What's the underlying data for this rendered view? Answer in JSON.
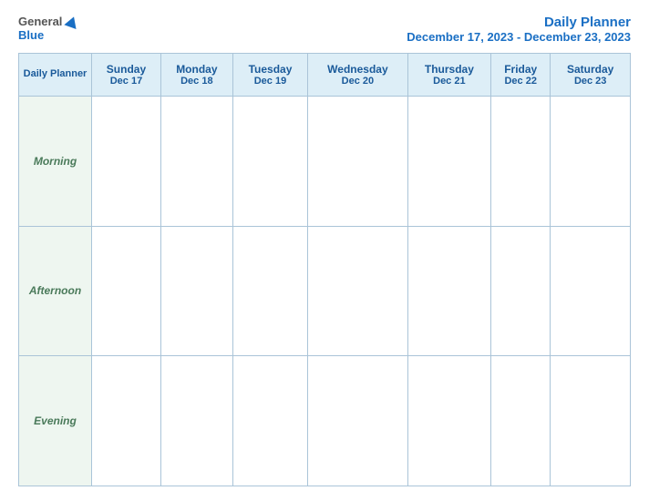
{
  "header": {
    "logo_general": "General",
    "logo_blue": "Blue",
    "title_main": "Daily Planner",
    "title_sub": "December 17, 2023 - December 23, 2023"
  },
  "table": {
    "daily_planner_label": "Daily Planner",
    "columns": [
      {
        "day": "Sunday",
        "date": "Dec 17"
      },
      {
        "day": "Monday",
        "date": "Dec 18"
      },
      {
        "day": "Tuesday",
        "date": "Dec 19"
      },
      {
        "day": "Wednesday",
        "date": "Dec 20"
      },
      {
        "day": "Thursday",
        "date": "Dec 21"
      },
      {
        "day": "Friday",
        "date": "Dec 22"
      },
      {
        "day": "Saturday",
        "date": "Dec 23"
      }
    ],
    "rows": [
      {
        "label": "Morning"
      },
      {
        "label": "Afternoon"
      },
      {
        "label": "Evening"
      }
    ]
  }
}
